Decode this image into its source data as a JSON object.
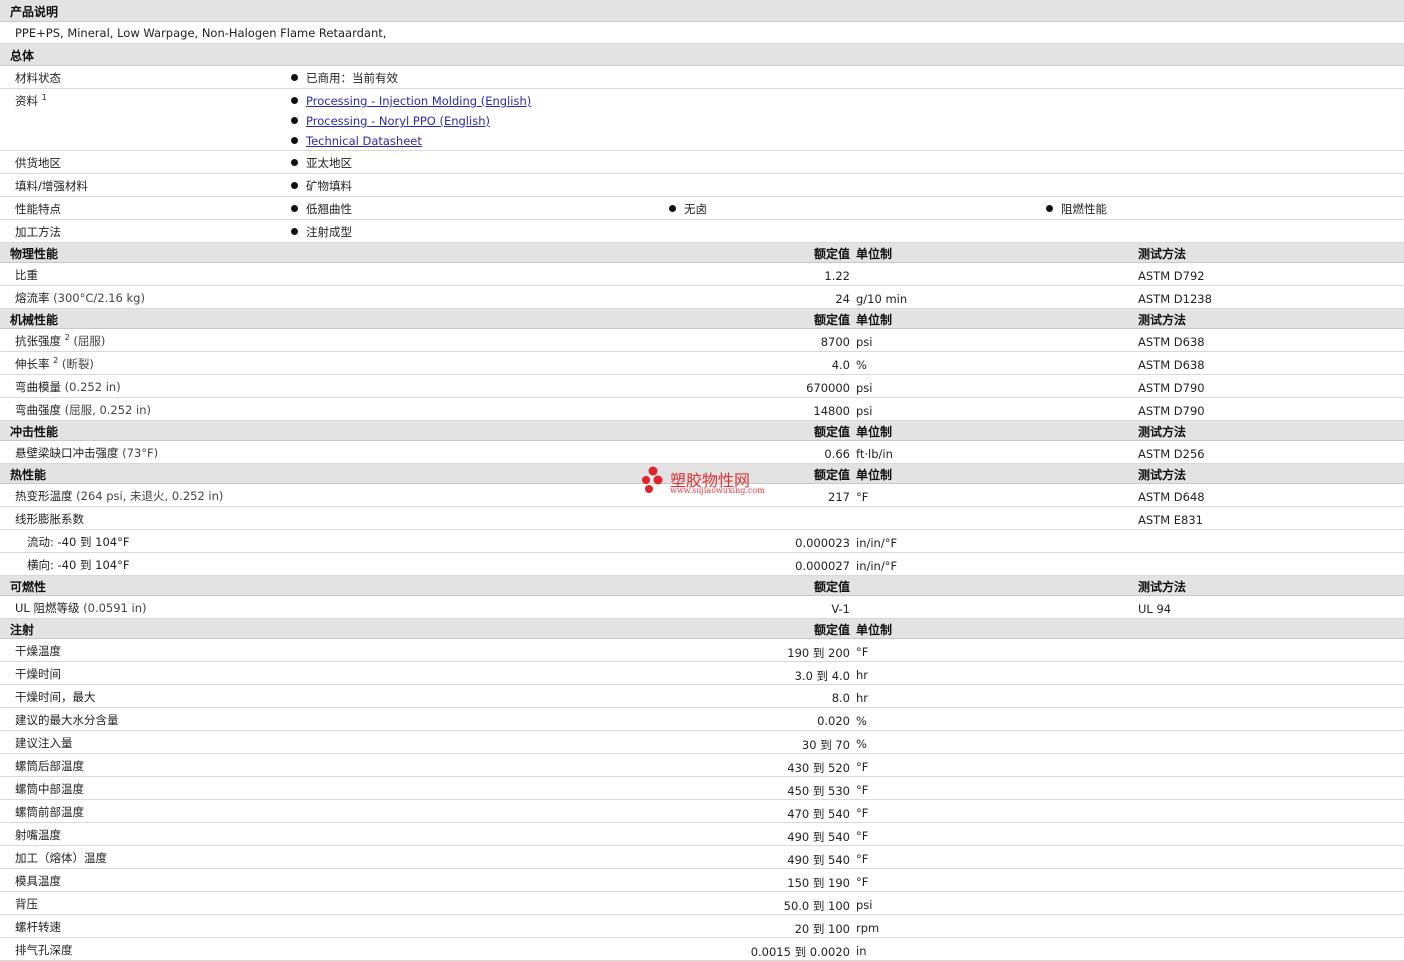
{
  "description": {
    "title": "产品说明",
    "text": "PPE+PS, Mineral, Low Warpage, Non-Halogen Flame Retaardant,"
  },
  "general": {
    "title": "总体",
    "rows": [
      {
        "label": "材料状态",
        "items": [
          "已商用：当前有效"
        ]
      },
      {
        "label": "资料",
        "sup": "1",
        "links": [
          "Processing - Injection Molding (English)",
          "Processing - Noryl PPO (English)",
          "Technical Datasheet"
        ]
      },
      {
        "label": "供货地区",
        "items": [
          "亚太地区"
        ]
      },
      {
        "label": "填料/增强材料",
        "items": [
          "矿物填料"
        ]
      },
      {
        "label": "性能特点",
        "items": [
          "低翘曲性",
          "无卤",
          "阻燃性能"
        ]
      },
      {
        "label": "加工方法",
        "items": [
          "注射成型"
        ]
      }
    ]
  },
  "columns": {
    "nominal": "额定值",
    "unit": "单位制",
    "test": "测试方法"
  },
  "physical": {
    "title": "物理性能",
    "rows": [
      {
        "label": "比重",
        "cond": "",
        "nominal": "1.22",
        "unit": "",
        "test": "ASTM D792"
      },
      {
        "label": "熔流率",
        "cond": "(300°C/2.16 kg)",
        "nominal": "24",
        "unit": "g/10 min",
        "test": "ASTM D1238"
      }
    ]
  },
  "mechanical": {
    "title": "机械性能",
    "rows": [
      {
        "label": "抗张强度",
        "sup": "2",
        "cond": "(屈服)",
        "nominal": "8700",
        "unit": "psi",
        "test": "ASTM D638"
      },
      {
        "label": "伸长率",
        "sup": "2",
        "cond": "(断裂)",
        "nominal": "4.0",
        "unit": "%",
        "test": "ASTM D638"
      },
      {
        "label": "弯曲模量",
        "cond": "(0.252 in)",
        "nominal": "670000",
        "unit": "psi",
        "test": "ASTM D790"
      },
      {
        "label": "弯曲强度",
        "cond": "(屈服, 0.252 in)",
        "nominal": "14800",
        "unit": "psi",
        "test": "ASTM D790"
      }
    ]
  },
  "impact": {
    "title": "冲击性能",
    "rows": [
      {
        "label": "悬壁梁缺口冲击强度",
        "cond": "(73°F)",
        "nominal": "0.66",
        "unit": "ft·lb/in",
        "test": "ASTM D256"
      }
    ]
  },
  "thermal": {
    "title": "热性能",
    "rows": [
      {
        "label": "热变形温度",
        "cond": "(264 psi, 未退火, 0.252 in)",
        "nominal": "217",
        "unit": "°F",
        "test": "ASTM D648"
      },
      {
        "label": "线形膨胀系数",
        "cond": "",
        "nominal": "",
        "unit": "",
        "test": "ASTM E831"
      },
      {
        "label": "流动: -40 到  104°F",
        "cond": "",
        "nominal": "0.000023",
        "unit": "in/in/°F",
        "test": "",
        "indent": true
      },
      {
        "label": "横向: -40 到  104°F",
        "cond": "",
        "nominal": "0.000027",
        "unit": "in/in/°F",
        "test": "",
        "indent": true
      }
    ]
  },
  "flammability": {
    "title": "可燃性",
    "rows": [
      {
        "label": "UL 阻燃等级",
        "cond": "(0.0591 in)",
        "nominal": "V-1",
        "unit": "",
        "test": "UL 94"
      }
    ]
  },
  "injection": {
    "title": "注射",
    "rows": [
      {
        "label": "干燥温度",
        "nominal": "190 到  200",
        "unit": "°F"
      },
      {
        "label": "干燥时间",
        "nominal": "3.0 到  4.0",
        "unit": "hr"
      },
      {
        "label": "干燥时间，最大",
        "nominal": "8.0",
        "unit": "hr"
      },
      {
        "label": "建议的最大水分含量",
        "nominal": "0.020",
        "unit": "%"
      },
      {
        "label": "建议注入量",
        "nominal": "30 到  70",
        "unit": "%"
      },
      {
        "label": "螺筒后部温度",
        "nominal": "430 到  520",
        "unit": "°F"
      },
      {
        "label": "螺筒中部温度",
        "nominal": "450 到  530",
        "unit": "°F"
      },
      {
        "label": "螺筒前部温度",
        "nominal": "470 到  540",
        "unit": "°F"
      },
      {
        "label": "射嘴温度",
        "nominal": "490 到  540",
        "unit": "°F"
      },
      {
        "label": "加工（熔体）温度",
        "nominal": "490 到  540",
        "unit": "°F"
      },
      {
        "label": "模具温度",
        "nominal": "150 到  190",
        "unit": "°F"
      },
      {
        "label": "背压",
        "nominal": "50.0 到  100",
        "unit": "psi"
      },
      {
        "label": "螺杆转速",
        "nominal": "20 到  100",
        "unit": "rpm"
      },
      {
        "label": "排气孔深度",
        "nominal": "0.0015 到  0.0020",
        "unit": "in"
      }
    ]
  },
  "watermark": {
    "text": "塑胶物性网",
    "url": "www.sujiaowuxing.com",
    "color": "#e0242b"
  }
}
